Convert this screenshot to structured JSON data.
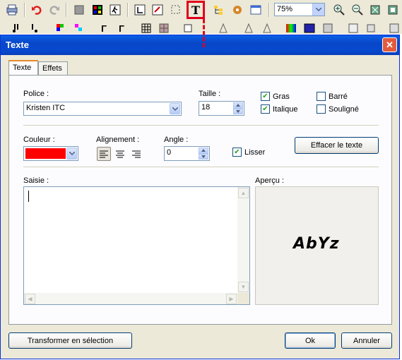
{
  "toolbar": {
    "zoom_value": "75%",
    "icons_row1": [
      "print-icon",
      "undo-icon",
      "redo-icon",
      "fill-icon",
      "palette-icon",
      "walk-icon",
      "crop-icon",
      "erase-icon",
      "select-icon",
      "text-tool-icon",
      "tree-icon",
      "puzzle-icon",
      "window-icon",
      "zoom-in-icon",
      "zoom-out-icon",
      "fit-icon",
      "actual-size-icon"
    ],
    "icons_row2": [
      "brush-icon",
      "pen-icon",
      "color-pick-icon",
      "color-swap-icon",
      "gamma-icon",
      "gamma2-icon",
      "grid-icon",
      "grid2-icon",
      "layer-icon",
      "flask-icon",
      "flask2-icon",
      "triangle-icon",
      "triangle2-icon",
      "rainbow-icon",
      "gradient-icon",
      "mask-icon",
      "book-icon",
      "cylinder-icon",
      "export-icon"
    ],
    "highlight_color": "#e0001b"
  },
  "dialog": {
    "title": "Texte",
    "close_label": "✕",
    "tabs": [
      {
        "label": "Texte"
      },
      {
        "label": "Effets"
      }
    ],
    "police_label": "Police :",
    "police_value": "Kristen ITC",
    "taille_label": "Taille :",
    "taille_value": "18",
    "gras_label": "Gras",
    "gras_checked": true,
    "italique_label": "Italique",
    "italique_checked": true,
    "barre_label": "Barré",
    "barre_checked": false,
    "souligne_label": "Souligné",
    "souligne_checked": false,
    "couleur_label": "Couleur :",
    "couleur_value": "#ff0000",
    "alignement_label": "Alignement :",
    "angle_label": "Angle :",
    "angle_value": "0",
    "lisser_label": "Lisser",
    "lisser_checked": true,
    "effacer_button": "Effacer le texte",
    "saisie_label": "Saisie :",
    "apercu_label": "Aperçu :",
    "apercu_text": "AbYz",
    "transformer_button": "Transformer en sélection",
    "ok_button": "Ok",
    "annuler_button": "Annuler"
  }
}
